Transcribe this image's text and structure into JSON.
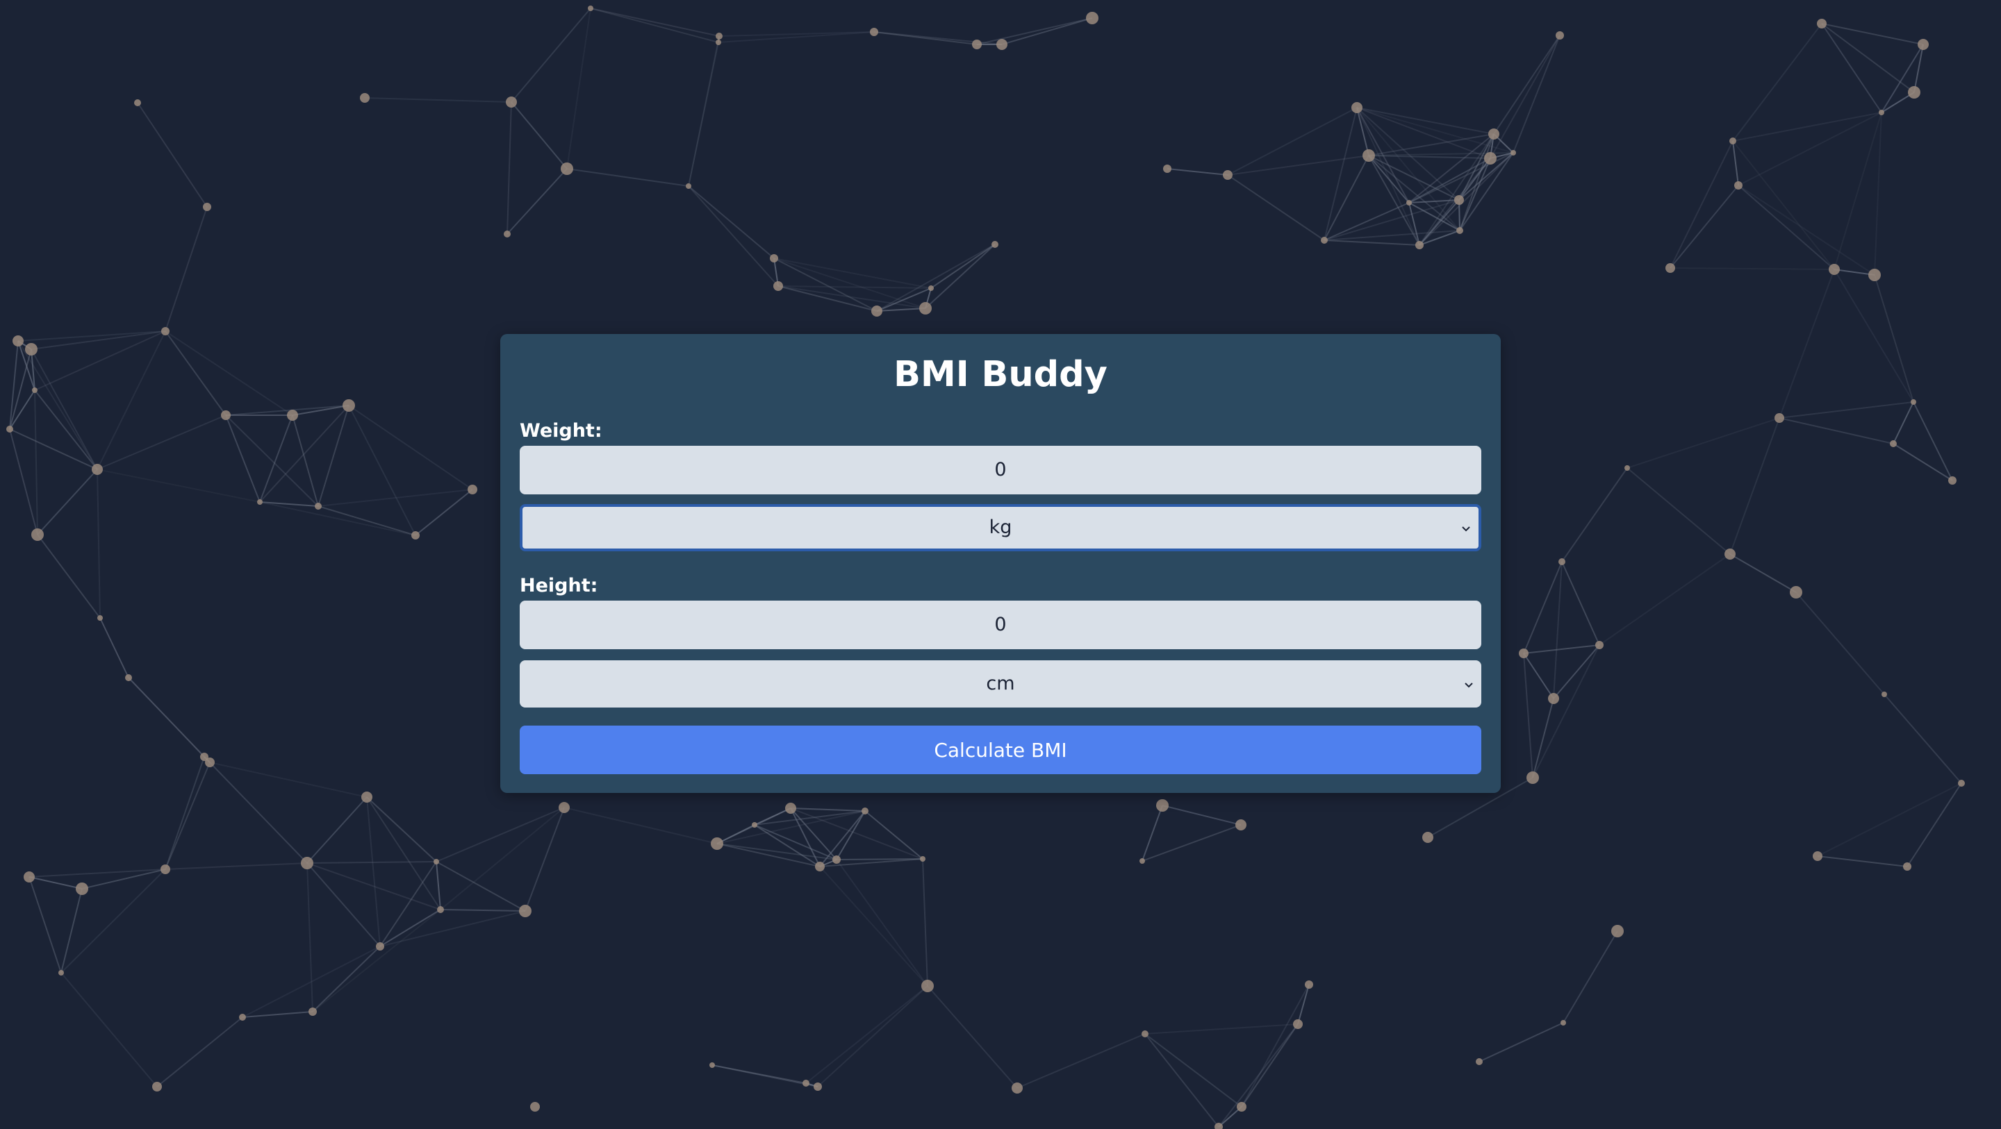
{
  "app": {
    "title": "BMI Buddy"
  },
  "form": {
    "weight_label": "Weight:",
    "weight_value": "0",
    "weight_unit": "kg",
    "height_label": "Height:",
    "height_value": "0",
    "height_unit": "cm",
    "submit_label": "Calculate BMI"
  },
  "colors": {
    "background": "#1b2335",
    "card": "#2c4c64",
    "field": "#d9e0e8",
    "button": "#4f80ee",
    "network_node": "#9a8a7c",
    "network_line": "#6b7384"
  },
  "icons": {
    "select_arrow": "chevron-down-icon"
  }
}
